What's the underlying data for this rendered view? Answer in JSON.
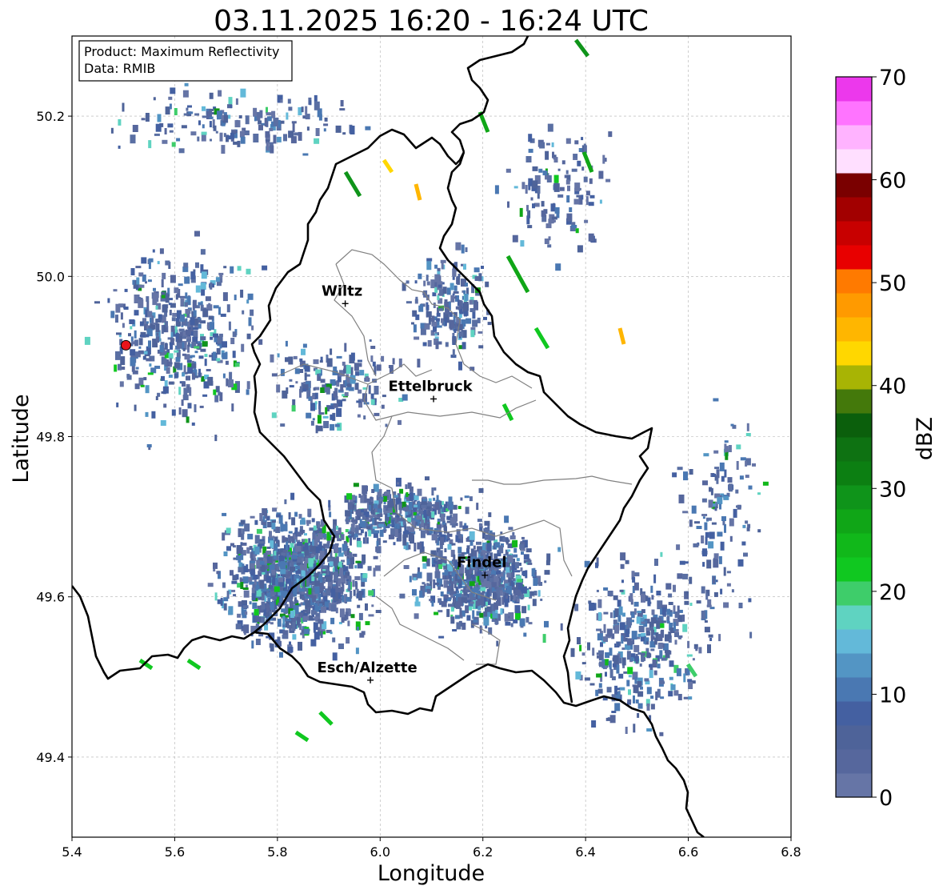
{
  "title": "03.11.2025 16:20 - 16:24 UTC",
  "info": {
    "product": "Product: Maximum Reflectivity",
    "data": "Data: RMIB"
  },
  "axes": {
    "xlabel": "Longitude",
    "ylabel": "Latitude",
    "xlim": [
      5.4,
      6.8
    ],
    "ylim": [
      49.3,
      50.3
    ],
    "xticks": [
      {
        "value": 5.4,
        "label": "5.4"
      },
      {
        "value": 5.6,
        "label": "5.6"
      },
      {
        "value": 5.8,
        "label": "5.8"
      },
      {
        "value": 6.0,
        "label": "6.0"
      },
      {
        "value": 6.2,
        "label": "6.2"
      },
      {
        "value": 6.4,
        "label": "6.4"
      },
      {
        "value": 6.6,
        "label": "6.6"
      },
      {
        "value": 6.8,
        "label": "6.8"
      }
    ],
    "yticks": [
      {
        "value": 49.4,
        "label": "49.4"
      },
      {
        "value": 49.6,
        "label": "49.6"
      },
      {
        "value": 49.8,
        "label": "49.8"
      },
      {
        "value": 50.0,
        "label": "50.0"
      },
      {
        "value": 50.2,
        "label": "50.2"
      }
    ],
    "grid": true
  },
  "colorbar": {
    "label": "dBZ",
    "range": [
      0,
      70
    ],
    "ticks": [
      {
        "value": 0,
        "label": "0"
      },
      {
        "value": 10,
        "label": "10"
      },
      {
        "value": 20,
        "label": "20"
      },
      {
        "value": 30,
        "label": "30"
      },
      {
        "value": 40,
        "label": "40"
      },
      {
        "value": 50,
        "label": "50"
      },
      {
        "value": 60,
        "label": "60"
      },
      {
        "value": 70,
        "label": "70"
      }
    ],
    "colors": [
      "#6675a6",
      "#56679d",
      "#4e6399",
      "#4460a1",
      "#4a78b2",
      "#5395c4",
      "#63b9d9",
      "#5fd3c1",
      "#3ecd6a",
      "#10c820",
      "#11b81a",
      "#10a617",
      "#0f941a",
      "#0c7f12",
      "#0e7212",
      "#0b5f0c",
      "#44790b",
      "#a8b404",
      "#ffd700",
      "#ffb600",
      "#ff9a00",
      "#ff7a00",
      "#e80000",
      "#c80000",
      "#a20000",
      "#7a0000",
      "#ffdfff",
      "#ffb3ff",
      "#ff74ff",
      "#ec38ec"
    ]
  },
  "cities": [
    {
      "name": "Wiltz",
      "lon": 5.932,
      "lat": 49.966
    },
    {
      "name": "Ettelbruck",
      "lon": 6.104,
      "lat": 49.847
    },
    {
      "name": "Findel",
      "lon": 6.204,
      "lat": 49.627
    },
    {
      "name": "Esch/Alzette",
      "lon": 5.981,
      "lat": 49.496
    }
  ],
  "radar_site": {
    "lon": 5.505,
    "lat": 49.914,
    "color": "#e8141c"
  },
  "colors": {
    "border": "#000000",
    "districts": "#808080",
    "grid": "#b0b0b0",
    "weak_echo": "#5a6fa3"
  }
}
